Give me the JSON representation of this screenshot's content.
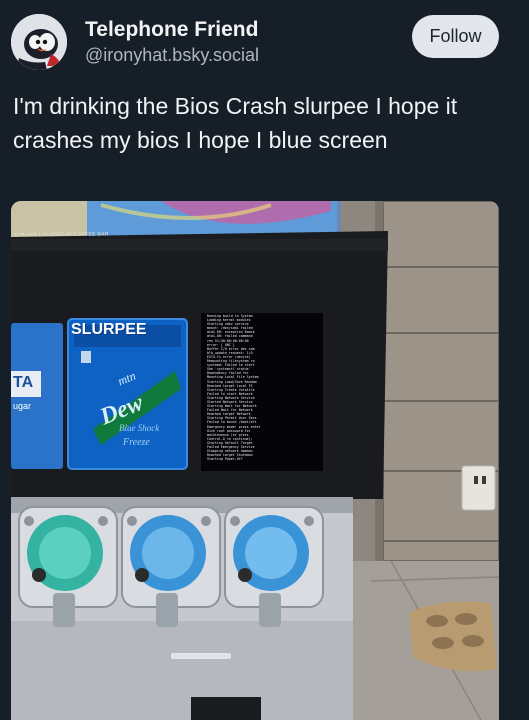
{
  "post": {
    "display_name": "Telephone Friend",
    "handle": "@ironyhat.bsky.social",
    "follow_label": "Follow",
    "text": "I'm drinking the Bios Crash slurpee I hope it crashes my bios I hope I blue screen"
  },
  "photo": {
    "sign_text": "STRAWS LOCATED AT COFFEE BAR",
    "panel_logo": "SLURPEE",
    "panel_brand": "Mtn Dew",
    "panel_flavor": "Blue Shock Freeze",
    "left_panel_letters": "TA",
    "left_panel_word": "ugar",
    "screen_lines": [
      "  Running build to System",
      "  Loading kernel modules",
      "  Starting udev service",
      "  mount: /dev/sda1 failed",
      "  ata1.00: exception Emask",
      "  ata1.00: failed command",
      "  res 51/40:00:00:00:00",
      "  error: { UNC }",
      "  Buffer I/O error dev sda",
      "  blk_update_request: I/O",
      "  EXT4-fs error (device)",
      "  Remounting filesystem ro",
      "  systemd: Failed to start",
      "  See 'systemctl status'",
      "  Dependency failed for",
      "  Mounting Local File System",
      "  Starting Load/Save Random",
      "  Reached target Local FS",
      "  Starting Create Volatile",
      "  Failed to start Network",
      "  Starting Network Service",
      "  Started Network Service",
      "  Starting Wait for Network",
      "  Failed Wait for Network",
      "  Reached target Network",
      "  Starting Permit User Sess",
      "  Failed to mount /boot/efi",
      "  Emergency mode: press enter",
      "  Give root password for",
      "  maintenance (or press",
      "  Control-D to continue):",
      "  Starting Default Target",
      "  Failed Emergency Service",
      "  Stopping network daemon",
      "  Reached target Shutdown",
      "  Starting Power-Off"
    ]
  }
}
